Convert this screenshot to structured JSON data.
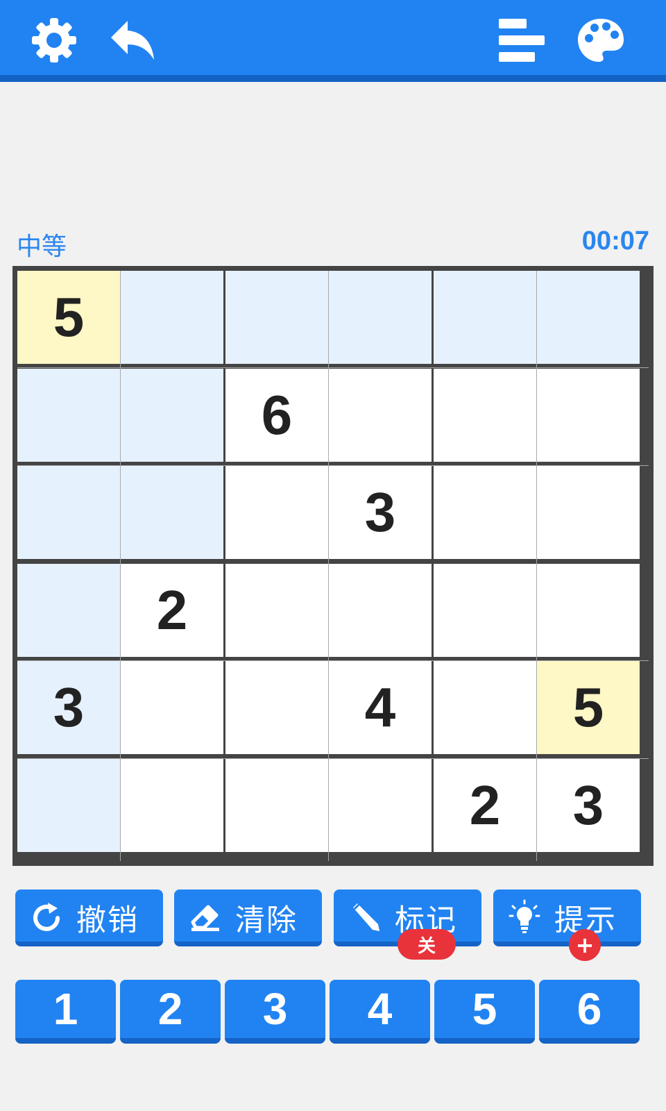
{
  "toolbar": {
    "settings_icon": "gear-icon",
    "back_icon": "undo-arrow-icon",
    "stats_icon": "bar-chart-icon",
    "theme_icon": "palette-icon"
  },
  "game": {
    "difficulty": "中等",
    "timer": "00:07"
  },
  "board": {
    "size": 6,
    "colors": {
      "highlight": "#e6f1fe",
      "selected": "#fef7c6",
      "plain": "#ffffff"
    },
    "rows": [
      [
        {
          "v": "5",
          "bg": "selected"
        },
        {
          "v": "",
          "bg": "highlight"
        },
        {
          "v": "",
          "bg": "highlight"
        },
        {
          "v": "",
          "bg": "highlight"
        },
        {
          "v": "",
          "bg": "highlight"
        },
        {
          "v": "",
          "bg": "highlight"
        }
      ],
      [
        {
          "v": "",
          "bg": "highlight"
        },
        {
          "v": "",
          "bg": "highlight"
        },
        {
          "v": "6",
          "bg": "plain"
        },
        {
          "v": "",
          "bg": "plain"
        },
        {
          "v": "",
          "bg": "plain"
        },
        {
          "v": "",
          "bg": "plain"
        }
      ],
      [
        {
          "v": "",
          "bg": "highlight"
        },
        {
          "v": "",
          "bg": "highlight"
        },
        {
          "v": "",
          "bg": "plain"
        },
        {
          "v": "3",
          "bg": "plain"
        },
        {
          "v": "",
          "bg": "plain"
        },
        {
          "v": "",
          "bg": "plain"
        }
      ],
      [
        {
          "v": "",
          "bg": "highlight"
        },
        {
          "v": "2",
          "bg": "plain"
        },
        {
          "v": "",
          "bg": "plain"
        },
        {
          "v": "",
          "bg": "plain"
        },
        {
          "v": "",
          "bg": "plain"
        },
        {
          "v": "",
          "bg": "plain"
        }
      ],
      [
        {
          "v": "3",
          "bg": "highlight"
        },
        {
          "v": "",
          "bg": "plain"
        },
        {
          "v": "",
          "bg": "plain"
        },
        {
          "v": "4",
          "bg": "plain"
        },
        {
          "v": "",
          "bg": "plain"
        },
        {
          "v": "5",
          "bg": "selected"
        }
      ],
      [
        {
          "v": "",
          "bg": "highlight"
        },
        {
          "v": "",
          "bg": "plain"
        },
        {
          "v": "",
          "bg": "plain"
        },
        {
          "v": "",
          "bg": "plain"
        },
        {
          "v": "2",
          "bg": "plain"
        },
        {
          "v": "3",
          "bg": "plain"
        }
      ]
    ]
  },
  "actions": {
    "undo": {
      "label": "撤销",
      "icon": "rotate-arrow-icon"
    },
    "erase": {
      "label": "清除",
      "icon": "eraser-icon"
    },
    "notes": {
      "label": "标记",
      "icon": "pencil-icon",
      "badge": "关"
    },
    "hint": {
      "label": "提示",
      "icon": "lightbulb-icon",
      "badge": "+"
    }
  },
  "numpad": [
    "1",
    "2",
    "3",
    "4",
    "5",
    "6"
  ]
}
